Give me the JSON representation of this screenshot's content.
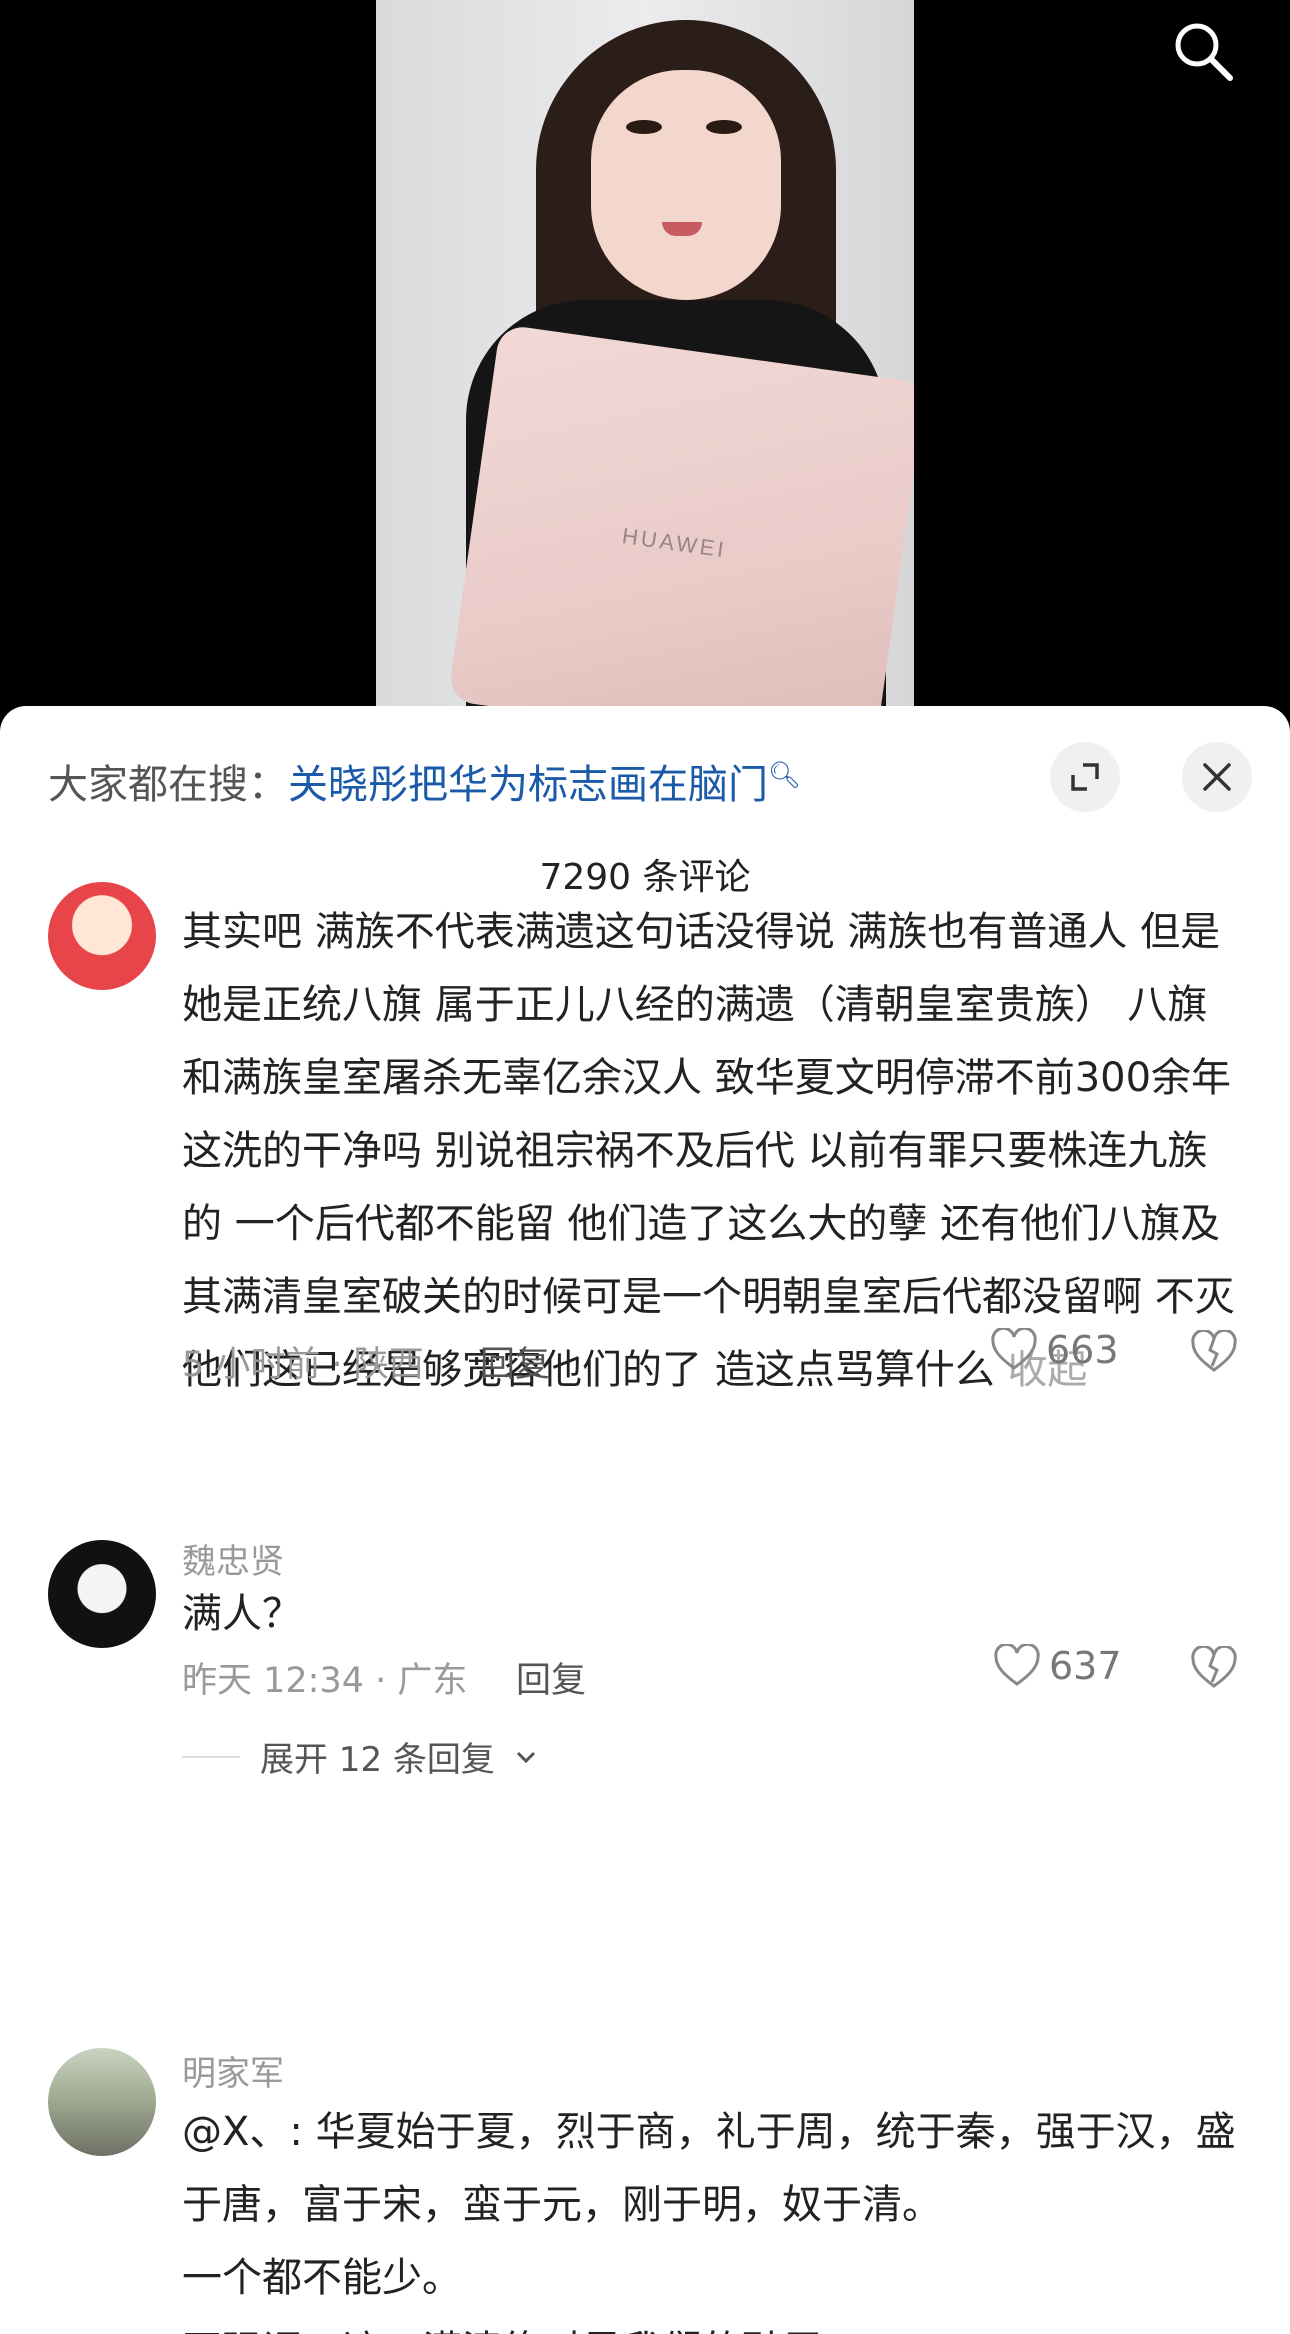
{
  "video": {
    "laptop_brand": "HUAWEI",
    "search_icon": "search-icon"
  },
  "sheet": {
    "hot_prefix": "大家都在搜：",
    "hot_link": "关晓彤把华为标志画在脑门",
    "expand_icon": "expand-icon",
    "close_icon": "close-icon",
    "comment_count": "7290 条评论"
  },
  "comments": [
    {
      "user": "",
      "text": "其实吧 满族不代表满遗这句话没得说 满族也有普通人 但是她是正统八旗 属于正儿八经的满遗（清朝皇室贵族） 八旗和满族皇室屠杀无辜亿余汉人 致华夏文明停滞不前300余年这洗的干净吗 别说祖宗祸不及后代 以前有罪只要株连九族的 一个后代都不能留 他们造了这么大的孽 还有他们八旗及其满清皇室破关的时候可是一个明朝皇室后代都没留啊 不灭他们这已经是够宽容他们的了 造这点骂算什么",
      "collapse": "收起",
      "meta": "5 小时前 · 陕西",
      "reply": "回复",
      "likes": "663"
    },
    {
      "user": "魏忠贤",
      "text": "满人？",
      "meta": "昨天 12:34 · 广东",
      "reply": "回复",
      "likes": "637",
      "expand": "展开 12 条回复"
    },
    {
      "user": "明家军",
      "text": "@X、: 华夏始于夏，烈于商，礼于周，统于秦，强于汉，盛于唐，富于宋，蛮于元，刚于明，奴于清。\n一个都不能少。\n再强调一遍，满清绝对是我们的耻辱！"
    }
  ],
  "colors": {
    "link": "#1a5aa8",
    "meta": "#999999"
  }
}
